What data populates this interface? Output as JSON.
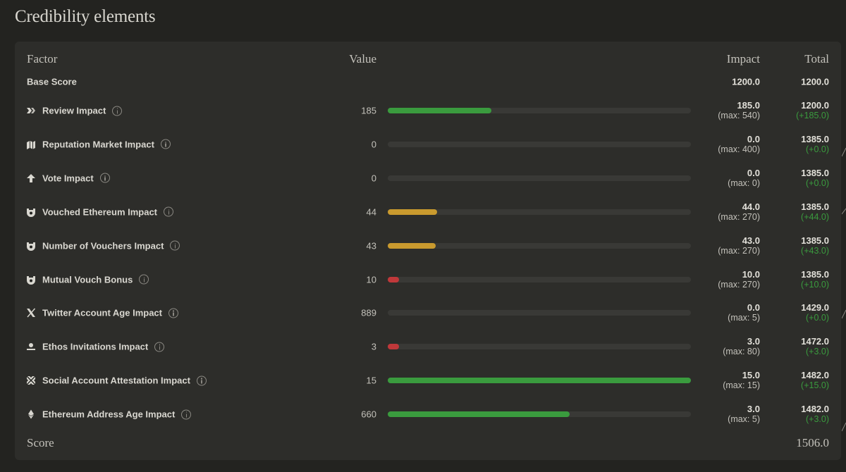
{
  "page": {
    "title": "Credibility elements"
  },
  "table": {
    "headers": {
      "factor": "Factor",
      "value": "Value",
      "impact": "Impact",
      "total": "Total"
    },
    "base": {
      "label": "Base Score",
      "impact": "1200.0",
      "total": "1200.0"
    },
    "rows": [
      {
        "label": "Review Impact",
        "icon": "review-icon",
        "value": "185",
        "progress": 0.343,
        "color": "#3a9b3e",
        "impact": "185.0",
        "max": "(max: 540)",
        "total": "1200.0",
        "delta": "(+185.0)"
      },
      {
        "label": "Reputation Market Impact",
        "icon": "market-icon",
        "value": "0",
        "progress": 0,
        "color": "#3a9b3e",
        "impact": "0.0",
        "max": "(max: 400)",
        "total": "1385.0",
        "delta": "(+0.0)"
      },
      {
        "label": "Vote Impact",
        "icon": "arrow-up-icon",
        "value": "0",
        "progress": 0,
        "color": "#3a9b3e",
        "impact": "0.0",
        "max": "(max: 0)",
        "total": "1385.0",
        "delta": "(+0.0)"
      },
      {
        "label": "Vouched Ethereum Impact",
        "icon": "vouch-icon",
        "value": "44",
        "progress": 0.163,
        "color": "#c99a2e",
        "impact": "44.0",
        "max": "(max: 270)",
        "total": "1385.0",
        "delta": "(+44.0)"
      },
      {
        "label": "Number of Vouchers Impact",
        "icon": "vouch-icon",
        "value": "43",
        "progress": 0.159,
        "color": "#c99a2e",
        "impact": "43.0",
        "max": "(max: 270)",
        "total": "1385.0",
        "delta": "(+43.0)"
      },
      {
        "label": "Mutual Vouch Bonus",
        "icon": "vouch-icon",
        "value": "10",
        "progress": 0.037,
        "color": "#c0383a",
        "impact": "10.0",
        "max": "(max: 270)",
        "total": "1385.0",
        "delta": "(+10.0)"
      },
      {
        "label": "Twitter Account Age Impact",
        "icon": "x-logo-icon",
        "value": "889",
        "progress": 0,
        "color": "#3a9b3e",
        "impact": "0.0",
        "max": "(max: 5)",
        "total": "1429.0",
        "delta": "(+0.0)"
      },
      {
        "label": "Ethos Invitations Impact",
        "icon": "invitation-icon",
        "value": "3",
        "progress": 0.0375,
        "color": "#c0383a",
        "impact": "3.0",
        "max": "(max: 80)",
        "total": "1472.0",
        "delta": "(+3.0)"
      },
      {
        "label": "Social Account Attestation Impact",
        "icon": "attestation-icon",
        "value": "15",
        "progress": 1,
        "color": "#3a9b3e",
        "impact": "15.0",
        "max": "(max: 15)",
        "total": "1482.0",
        "delta": "(+15.0)"
      },
      {
        "label": "Ethereum Address Age Impact",
        "icon": "ethereum-icon",
        "value": "660",
        "progress": 0.6,
        "color": "#3a9b3e",
        "impact": "3.0",
        "max": "(max: 5)",
        "total": "1482.0",
        "delta": "(+3.0)"
      }
    ],
    "score": {
      "label": "Score",
      "value": "1506.0"
    }
  }
}
